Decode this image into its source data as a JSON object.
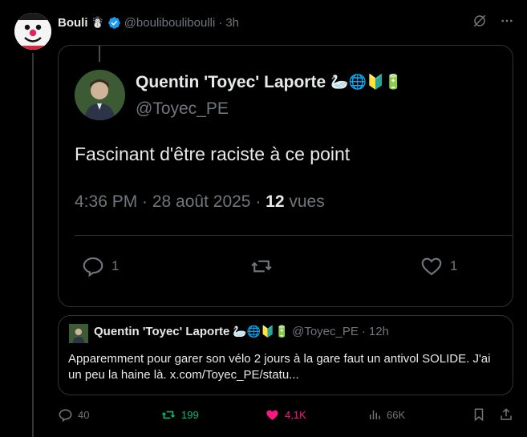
{
  "post": {
    "author_name": "Bouli",
    "author_emoji": "☃️",
    "handle": "@boulibouliboulli",
    "separator": "·",
    "time": "3h"
  },
  "screenshot": {
    "name": "Quentin 'Toyec' Laporte",
    "emojis": "🦢🌐🔰🔋",
    "handle": "@Toyec_PE",
    "text": "Fascinant d'être raciste à ce point",
    "meta_prefix": "4:36 PM · 28 août 2025 · ",
    "views_count": "12",
    "views_label": " vues",
    "replies": "1",
    "likes": "1"
  },
  "quote": {
    "name": "Quentin 'Toyec' Laporte",
    "emojis": "🦢🌐🔰🔋",
    "handle": "@Toyec_PE",
    "separator": "·",
    "time": "12h",
    "text": "Apparemment pour garer son vélo 2 jours à la gare faut un antivol SOLIDE. J'ai un peu la haine là. x.com/Toyec_PE/statu..."
  },
  "actions": {
    "replies": "40",
    "reposts": "199",
    "likes": "4,1K",
    "views": "66K"
  },
  "colors": {
    "background": "#000000",
    "text": "#e7e9ea",
    "muted": "#71767b",
    "verified": "#1d9bf0",
    "repost": "#00ba7c",
    "like": "#f91880",
    "border": "#2f3336"
  }
}
